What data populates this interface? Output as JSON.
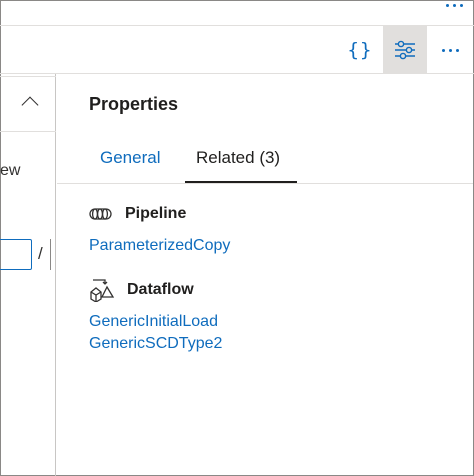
{
  "toolbar": {
    "code_label": "{}"
  },
  "left_pane": {
    "partial_text": "ew",
    "separator": "/"
  },
  "panel": {
    "title": "Properties",
    "tabs": [
      {
        "label": "General",
        "active": false
      },
      {
        "label": "Related (3)",
        "active": true
      }
    ],
    "sections": [
      {
        "label": "Pipeline",
        "icon": "pipeline-icon",
        "items": [
          "ParameterizedCopy"
        ]
      },
      {
        "label": "Dataflow",
        "icon": "dataflow-icon",
        "items": [
          "GenericInitialLoad",
          "GenericSCDType2"
        ]
      }
    ]
  },
  "colors": {
    "accent": "#0f6cbd",
    "selected_button_bg": "#e1dfdd",
    "text": "#201f1e"
  }
}
